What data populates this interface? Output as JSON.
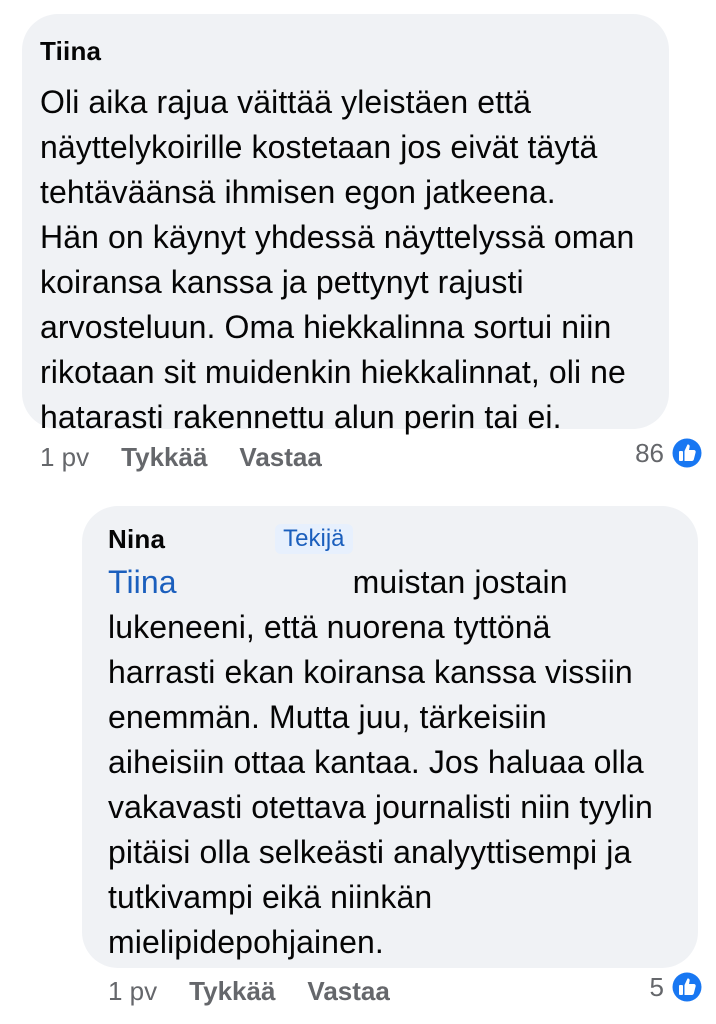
{
  "comments": [
    {
      "author": "Tiina",
      "lines": [
        "Oli aika rajua väittää yleistäen että",
        "näyttelykoirille kostetaan jos eivät täytä",
        "tehtäväänsä ihmisen egon jatkeena.",
        "Hän on käynyt yhdessä näyttelyssä oman",
        "koiransa kanssa ja pettynyt rajusti",
        "arvosteluun. Oma hiekkalinna sortui niin",
        "rikotaan sit muidenkin hiekkalinnat, oli ne",
        "hatarasti rakennettu alun perin tai ei."
      ],
      "time": "1 pv",
      "like_label": "Tykkää",
      "reply_label": "Vastaa",
      "reaction_count": "86",
      "reaction_icon": "like-icon",
      "reaction_color": "#1877f2"
    },
    {
      "author": "Nina",
      "badge": "Tekijä",
      "mention": "Tiina",
      "lines": [
        "muistan jostain",
        "lukeneeni, että nuorena tyttönä",
        "harrasti ekan koiransa kanssa vissiin",
        "enemmän. Mutta juu, tärkeisiin",
        "aiheisiin ottaa kantaa. Jos haluaa olla",
        "vakavasti otettava journalisti niin tyylin",
        "pitäisi olla selkeästi analyyttisempi ja",
        "tutkivampi eikä niinkän",
        "mielipidepohjainen."
      ],
      "time": "1 pv",
      "like_label": "Tykkää",
      "reply_label": "Vastaa",
      "reaction_count": "5",
      "reaction_icon": "like-icon",
      "reaction_color": "#1877f2"
    }
  ]
}
